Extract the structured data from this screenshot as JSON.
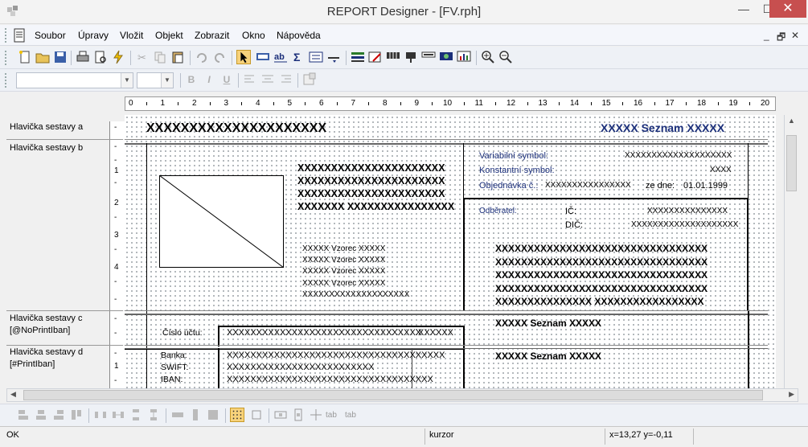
{
  "window": {
    "title": "REPORT Designer - [FV.rph]",
    "controls": {
      "minimize": "—",
      "maximize": "☐",
      "close": "✕"
    }
  },
  "menu": {
    "items": [
      "Soubor",
      "Úpravy",
      "Vložit",
      "Objekt",
      "Zobrazit",
      "Okno",
      "Nápověda"
    ],
    "mdi_controls": [
      "_",
      "🗗",
      "✕"
    ]
  },
  "ruler": {
    "numbers": [
      "0",
      "1",
      "2",
      "3",
      "4",
      "5",
      "6",
      "7",
      "8",
      "9",
      "10",
      "11",
      "12",
      "13",
      "14",
      "15",
      "16",
      "17",
      "18",
      "19",
      "20"
    ]
  },
  "bands": [
    {
      "label": "Hlavička sestavy a"
    },
    {
      "label": "Hlavička sestavy b"
    },
    {
      "label": "Hlavička sestavy c\n[@NoPrintIban]"
    },
    {
      "label": "Hlavička sestavy d\n[#PrintIban]"
    }
  ],
  "rule_numbers": [
    "1",
    "2",
    "3",
    "4",
    "1"
  ],
  "canvas": {
    "band_a_left": "XXXXXXXXXXXXXXXXXXXXX",
    "band_a_right": "XXXXX Seznam XXXXX",
    "address_lines": [
      "XXXXXXXXXXXXXXXXXXXXXX",
      "XXXXXXXXXXXXXXXXXXXXXX",
      "XXXXXXXXXXXXXXXXXXXXXX",
      "XXXXXXX XXXXXXXXXXXXXXXX"
    ],
    "formula_lines": [
      "XXXXX Vzorec XXXXX",
      "XXXXX Vzorec XXXXX",
      "XXXXX Vzorec XXXXX",
      "XXXXX Vzorec XXXXX",
      "XXXXXXXXXXXXXXXXXXXX"
    ],
    "variabilni_label": "Variabilní symbol:",
    "variabilni_value": "XXXXXXXXXXXXXXXXXXXX",
    "konstantni_label": "Konstantní symbol:",
    "konstantni_value": "XXXX",
    "objednavka_label": "Objednávka č.:",
    "objednavka_value": "XXXXXXXXXXXXXXXX",
    "ze_dne_label": "ze dne:",
    "ze_dne_value": "01.01.1999",
    "odberatel_label": "Odběratel:",
    "ic_label": "IČ:",
    "ic_value": "XXXXXXXXXXXXXXX",
    "dic_label": "DIČ:",
    "dic_value": "XXXXXXXXXXXXXXXXXXXX",
    "customer_lines": [
      "XXXXXXXXXXXXXXXXXXXXXXXXXXXXXXXXX",
      "XXXXXXXXXXXXXXXXXXXXXXXXXXXXXXXXX",
      "XXXXXXXXXXXXXXXXXXXXXXXXXXXXXXXXX",
      "XXXXXXXXXXXXXXXXXXXXXXXXXXXXXXXXX",
      "XXXXXXXXXXXXXXX XXXXXXXXXXXXXXXXX"
    ],
    "cislo_uctu_label": "Číslo účtu:",
    "cislo_uctu_value": "XXXXXXXXXXXXXXXXXXXXXXXXXXXXXXXXX",
    "cislo_uctu_suffix": "XXXXXX",
    "band_c_seznam": "XXXXX Seznam XXXXX",
    "banka_label": "Banka:",
    "banka_value": "XXXXXXXXXXXXXXXXXXXXXXXXXXXXXXXXXXXXX",
    "swift_label": "SWIFT:",
    "swift_value": "XXXXXXXXXXXXXXXXXXXXXXXXX",
    "iban_label": "IBAN:",
    "iban_value": "XXXXXXXXXXXXXXXXXXXXXXXXXXXXXXXXXXX",
    "band_d_seznam": "XXXXX Seznam XXXXX"
  },
  "status": {
    "left": "OK",
    "mid": "kurzor",
    "coords": "x=13,27  y=-0,11"
  },
  "colors": {
    "accent": "#1b2f7a",
    "close": "#c74f4f",
    "marker": "#cc0000"
  }
}
